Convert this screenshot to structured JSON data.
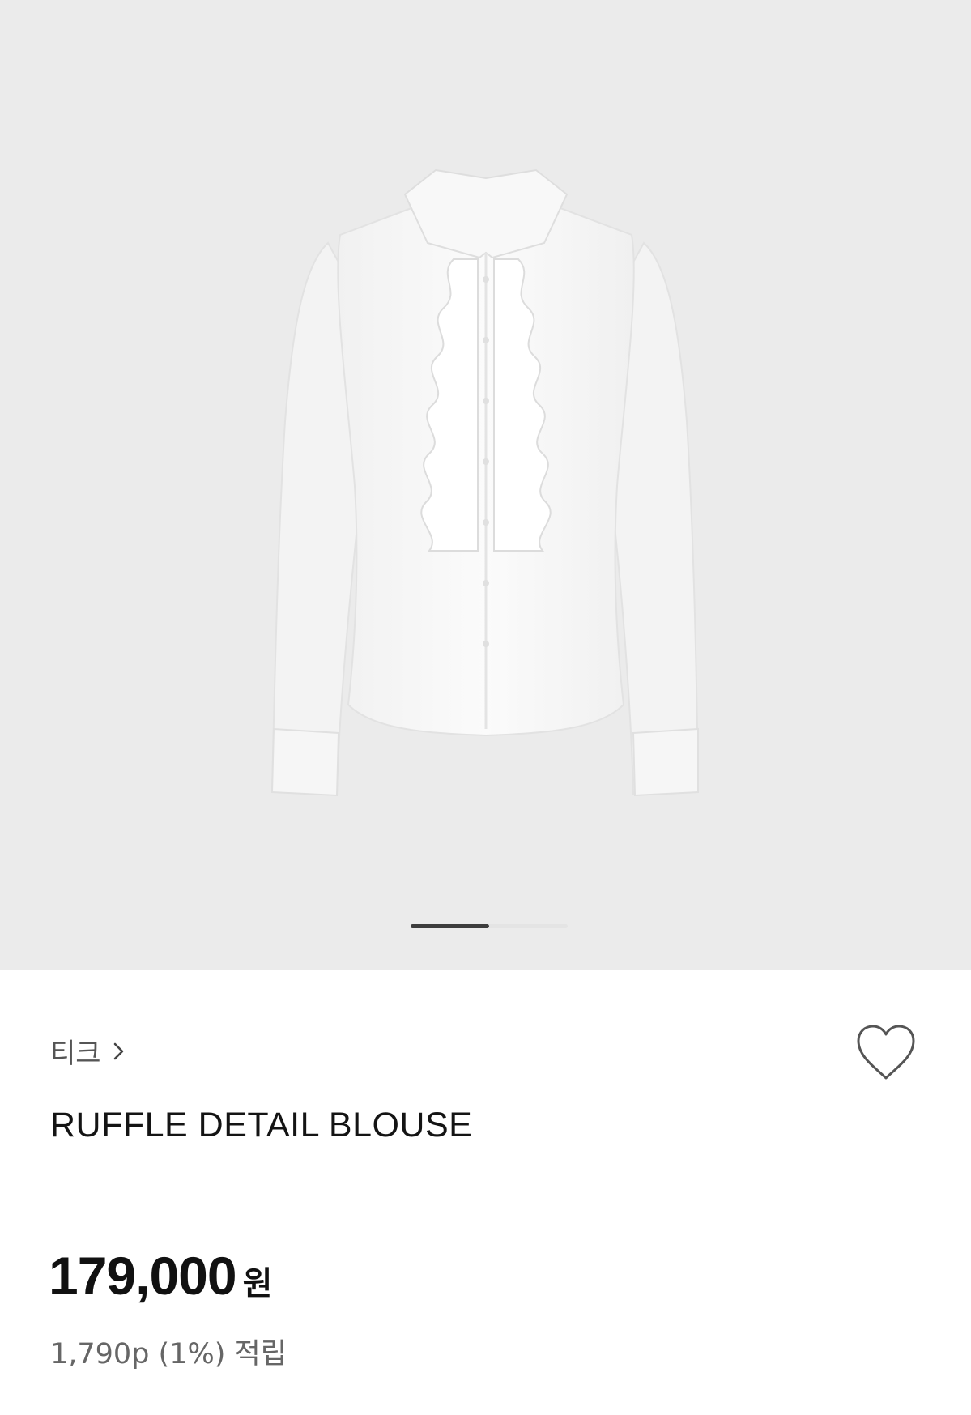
{
  "gallery": {
    "image_alt": "white-ruffle-blouse-photo",
    "slide_count": 2,
    "active_slide": 1
  },
  "product": {
    "brand": "티크",
    "name": "RUFFLE DETAIL BLOUSE",
    "price": "179,000",
    "currency": "원",
    "points": "1,790p (1%) 적립"
  },
  "icons": {
    "brand_chevron": "chevron-right-icon",
    "wishlist": "heart-outline-icon"
  },
  "colors": {
    "background": "#ffffff",
    "gallery_bg": "#ebebeb",
    "indicator_active": "#3d3d3d",
    "indicator_track": "#e4e4e4",
    "text_primary": "#111111",
    "text_secondary": "#666666"
  }
}
